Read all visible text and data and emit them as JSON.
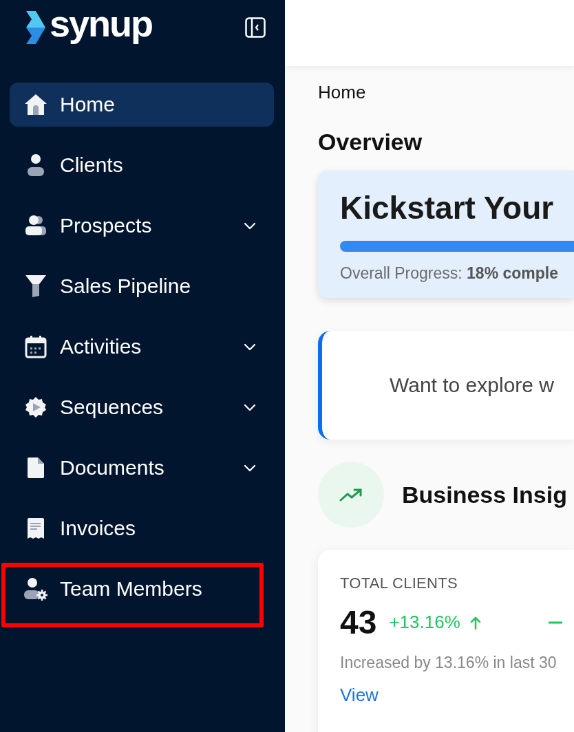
{
  "sidebar": {
    "logo": "synup",
    "items": [
      {
        "label": "Home",
        "kind": "home",
        "selected": true,
        "expandable": false,
        "highlighted": false
      },
      {
        "label": "Clients",
        "kind": "person",
        "selected": false,
        "expandable": false,
        "highlighted": false
      },
      {
        "label": "Prospects",
        "kind": "people",
        "selected": false,
        "expandable": true,
        "highlighted": false
      },
      {
        "label": "Sales Pipeline",
        "kind": "funnel",
        "selected": false,
        "expandable": false,
        "highlighted": false
      },
      {
        "label": "Activities",
        "kind": "calendar",
        "selected": false,
        "expandable": true,
        "highlighted": false
      },
      {
        "label": "Sequences",
        "kind": "sequence",
        "selected": false,
        "expandable": true,
        "highlighted": false
      },
      {
        "label": "Documents",
        "kind": "document",
        "selected": false,
        "expandable": true,
        "highlighted": false
      },
      {
        "label": "Invoices",
        "kind": "receipt",
        "selected": false,
        "expandable": false,
        "highlighted": false
      },
      {
        "label": "Team Members",
        "kind": "team",
        "selected": false,
        "expandable": false,
        "highlighted": true
      }
    ]
  },
  "breadcrumb": "Home",
  "page_title": "Overview",
  "kickstart_card": {
    "title": "Kickstart Your",
    "progress": {
      "level": 1
    },
    "progress_text": "Overall Progress: **18% comple**"
  },
  "explore_banner": {
    "text": "Want to explore w"
  },
  "insights": {
    "title": "Business Insig"
  },
  "stat_card": {
    "label": "TOTAL CLIENTS",
    "value": "43",
    "change": "+13.16%",
    "note": "Increased by 13.16% in last 30",
    "link": "View"
  }
}
